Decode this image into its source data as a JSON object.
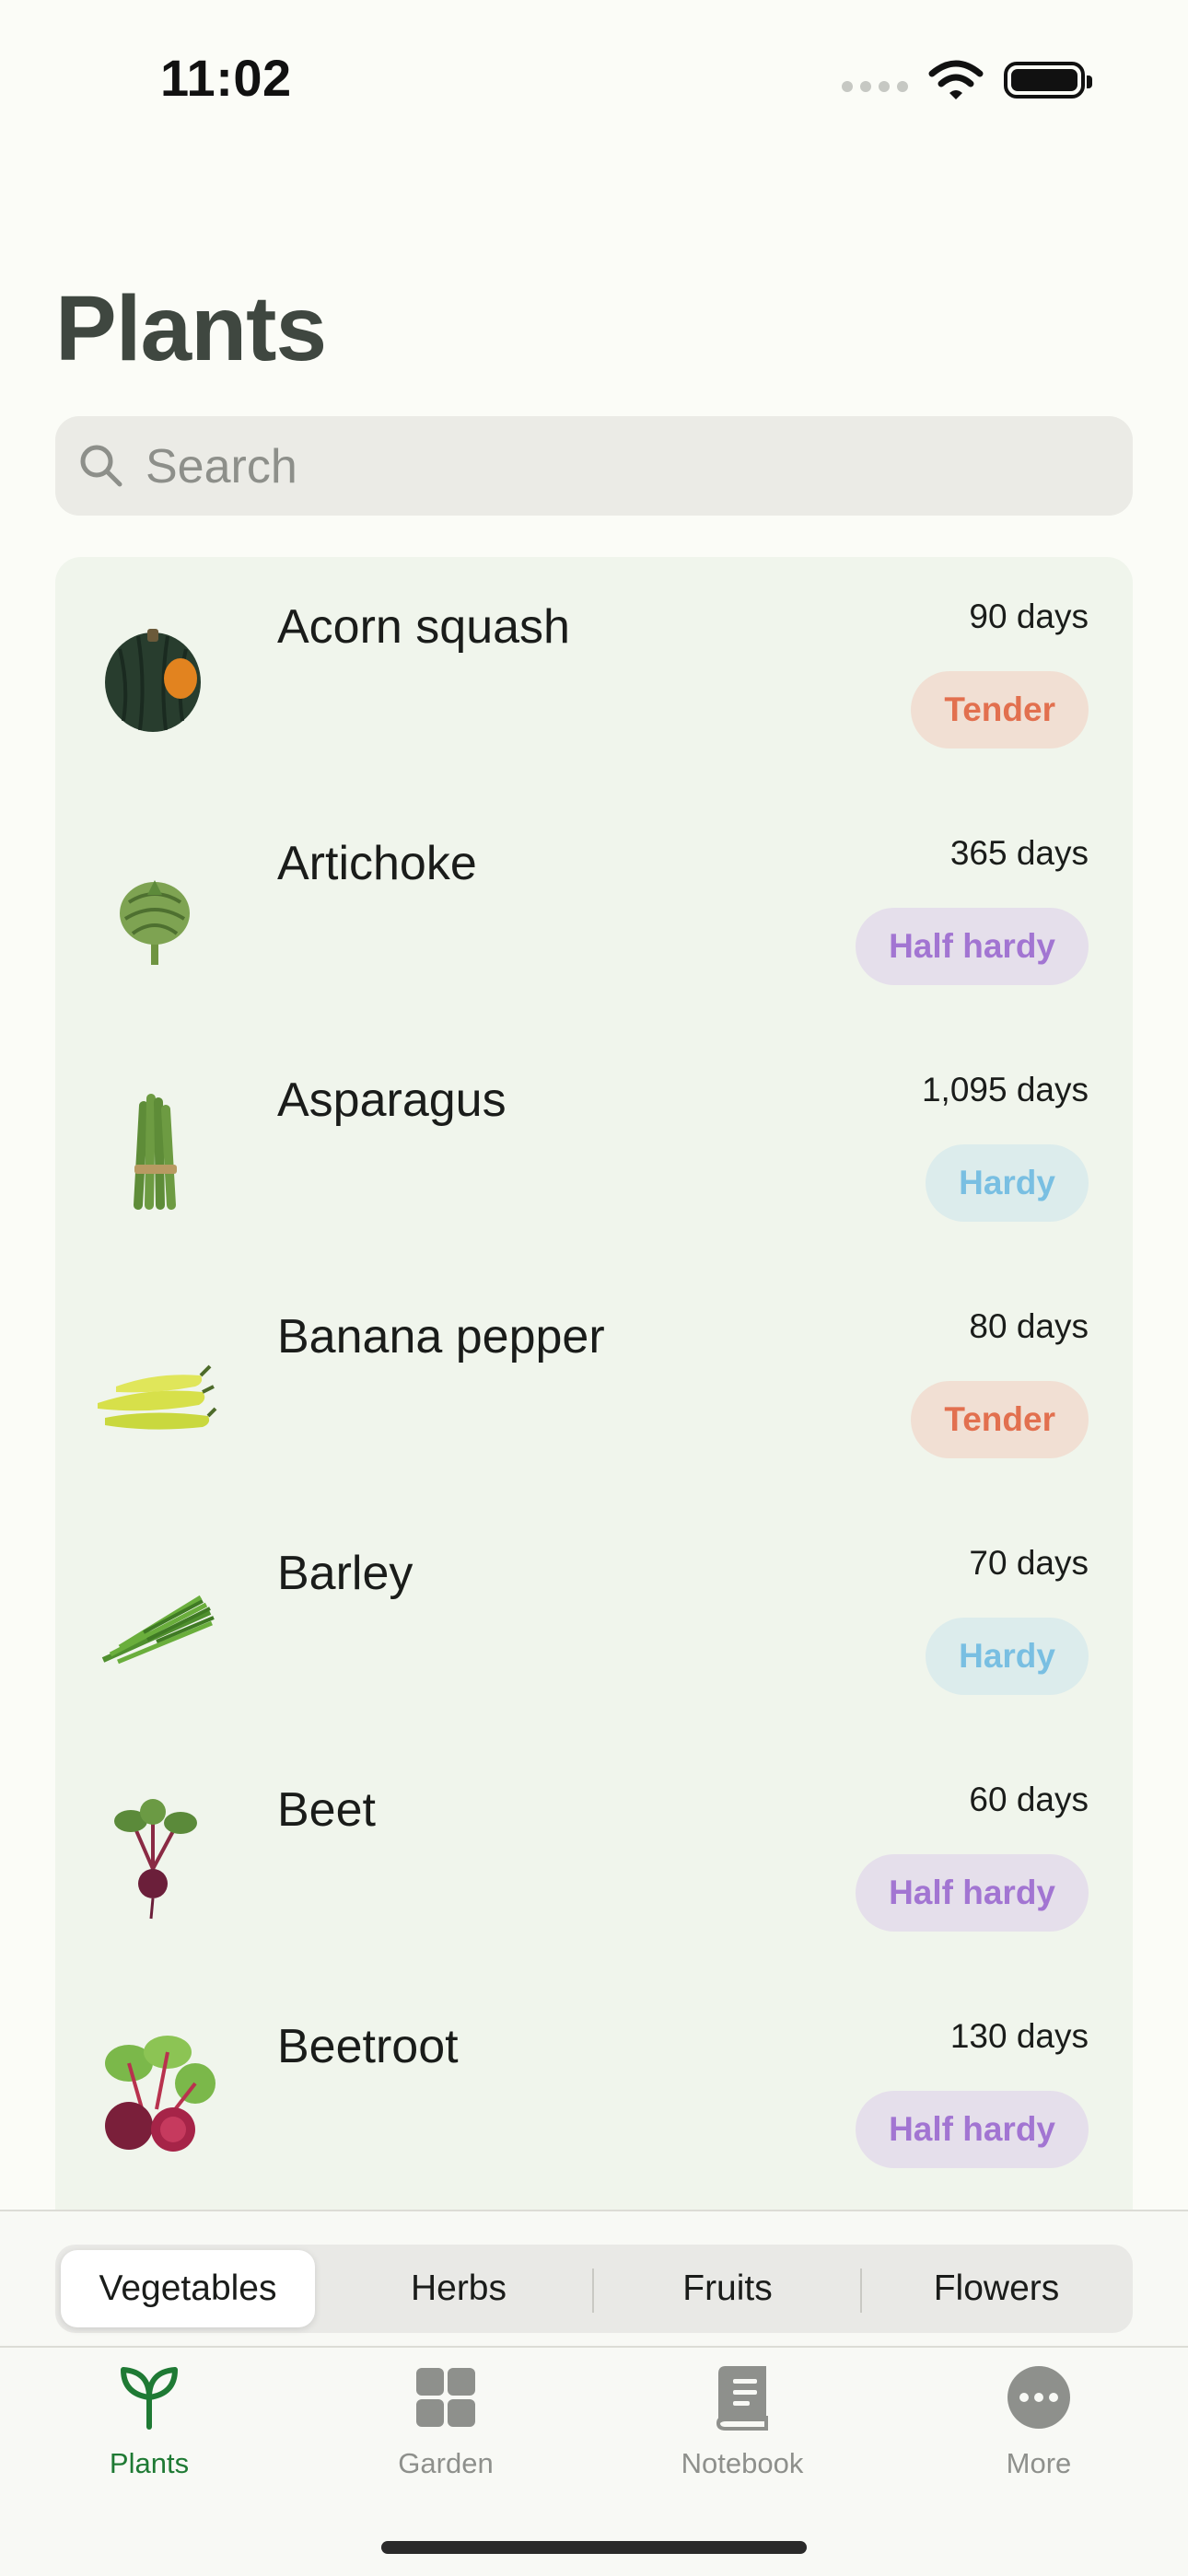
{
  "status_bar": {
    "time": "11:02"
  },
  "header": {
    "title": "Plants"
  },
  "search": {
    "placeholder": "Search"
  },
  "plants": [
    {
      "name": "Acorn squash",
      "days": "90 days",
      "hardiness": "Tender"
    },
    {
      "name": "Artichoke",
      "days": "365 days",
      "hardiness": "Half hardy"
    },
    {
      "name": "Asparagus",
      "days": "1,095 days",
      "hardiness": "Hardy"
    },
    {
      "name": "Banana pepper",
      "days": "80 days",
      "hardiness": "Tender"
    },
    {
      "name": "Barley",
      "days": "70 days",
      "hardiness": "Hardy"
    },
    {
      "name": "Beet",
      "days": "60 days",
      "hardiness": "Half hardy"
    },
    {
      "name": "Beetroot",
      "days": "130 days",
      "hardiness": "Half hardy"
    }
  ],
  "categories": {
    "items": [
      "Vegetables",
      "Herbs",
      "Fruits",
      "Flowers"
    ],
    "selected": "Vegetables"
  },
  "tab_bar": {
    "items": [
      {
        "label": "Plants",
        "icon": "sprout-icon",
        "active": true
      },
      {
        "label": "Garden",
        "icon": "grid-icon",
        "active": false
      },
      {
        "label": "Notebook",
        "icon": "book-icon",
        "active": false
      },
      {
        "label": "More",
        "icon": "more-icon",
        "active": false
      }
    ]
  },
  "colors": {
    "accent_green": "#1f7a34",
    "tender_text": "#e2704f",
    "tender_bg": "#f1dfd3",
    "half_hardy_text": "#a275d2",
    "half_hardy_bg": "#e5dfeb",
    "hardy_text": "#79bfe2",
    "hardy_bg": "#dcecec"
  }
}
